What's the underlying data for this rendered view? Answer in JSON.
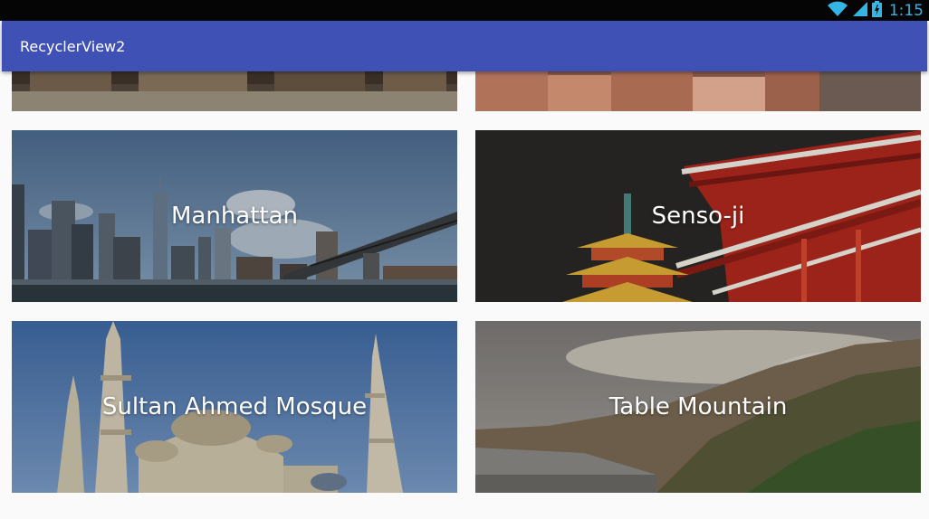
{
  "status_bar": {
    "time": "1:15",
    "icons": [
      "wifi-icon",
      "cell-signal-icon",
      "battery-icon"
    ]
  },
  "app_bar": {
    "title": "RecyclerView2",
    "color": "#3f51b5"
  },
  "places": [
    {
      "name": ""
    },
    {
      "name": ""
    },
    {
      "name": "Manhattan"
    },
    {
      "name": "Senso-ji"
    },
    {
      "name": "Sultan Ahmed Mosque"
    },
    {
      "name": "Table Mountain"
    }
  ]
}
